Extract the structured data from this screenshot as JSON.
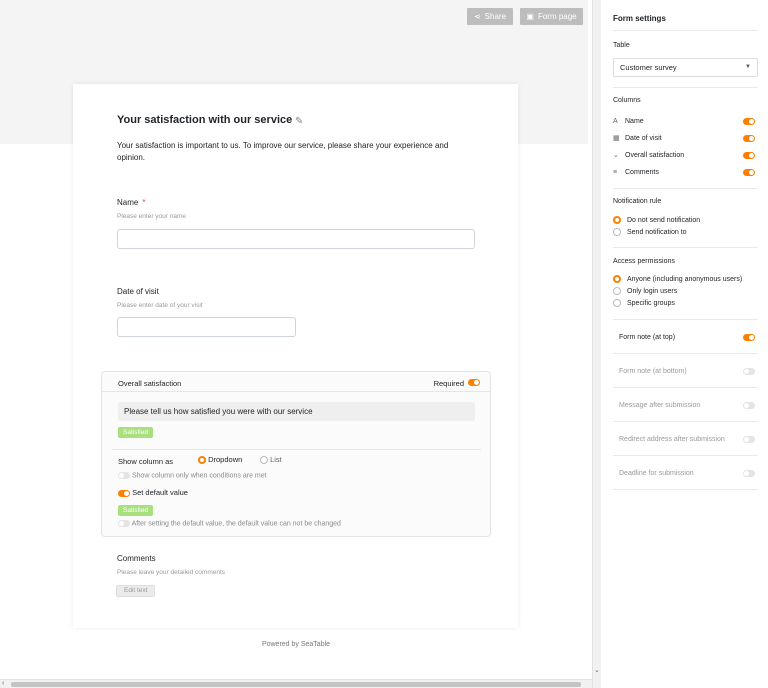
{
  "toolbar": {
    "share_label": "Share",
    "form_page_label": "Form page"
  },
  "form": {
    "title": "Your satisfaction with our service",
    "description": "Your satisfaction is important to us. To improve our service, please share your experience and opinion.",
    "fields": {
      "name": {
        "label": "Name",
        "required_mark": "*",
        "description": "Please enter your name"
      },
      "date": {
        "label": "Date of visit",
        "description": "Please enter date of your visit"
      },
      "satisfaction": {
        "label": "Overall satisfaction",
        "required_label": "Required",
        "question": "Please tell us how satisfied you were with our service",
        "option_tag": "Satisfied",
        "show_column_as_label": "Show column as",
        "dropdown_label": "Dropdown",
        "list_label": "List",
        "conditional_label": "Show column only when conditions are met",
        "default_value_label": "Set default value",
        "default_tag": "Satisfied",
        "lock_default_label": "After setting the default value, the default value can not be changed"
      },
      "comments": {
        "label": "Comments",
        "description": "Please leave your detailed comments",
        "button_label": "Edit text"
      }
    },
    "footer": "Powered by SeaTable"
  },
  "sidebar": {
    "title": "Form settings",
    "table_label": "Table",
    "table_value": "Customer survey",
    "columns_label": "Columns",
    "columns": [
      {
        "icon": "A",
        "label": "Name",
        "on": true
      },
      {
        "icon": "▦",
        "label": "Date of visit",
        "on": true
      },
      {
        "icon": "⌄",
        "label": "Overall satisfaction",
        "on": true
      },
      {
        "icon": "≡",
        "label": "Comments",
        "on": true
      }
    ],
    "notification_label": "Notification rule",
    "notification_options": [
      {
        "label": "Do not send notification",
        "selected": true
      },
      {
        "label": "Send notification to",
        "selected": false
      }
    ],
    "access_label": "Access permissions",
    "access_options": [
      {
        "label": "Anyone (including anonymous users)",
        "selected": true
      },
      {
        "label": "Only login users",
        "selected": false
      },
      {
        "label": "Specific groups",
        "selected": false
      }
    ],
    "settings": [
      {
        "label": "Form note (at top)",
        "on": true
      },
      {
        "label": "Form note (at bottom)",
        "on": false
      },
      {
        "label": "Message after submission",
        "on": false
      },
      {
        "label": "Redirect address after submission",
        "on": false
      },
      {
        "label": "Deadline for submission",
        "on": false
      }
    ]
  },
  "colors": {
    "accent": "#ff8000",
    "tag": "#a8e07e"
  }
}
